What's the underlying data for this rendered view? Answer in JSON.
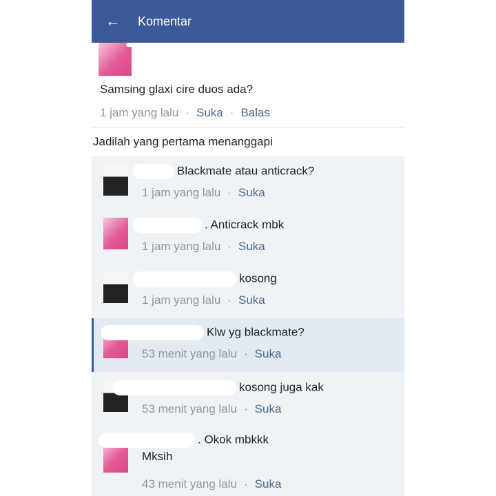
{
  "header": {
    "title": "Komentar"
  },
  "icons": {
    "back": "arrow-left-icon"
  },
  "post": {
    "text": "Samsing glaxi cire duos ada?",
    "time": "1 jam yang lalu",
    "like": "Suka",
    "reply": "Balas"
  },
  "first_reply_prompt": "Jadilah yang pertama menanggapi",
  "replies": [
    {
      "text": "Blackmate atau anticrack?",
      "time": "1 jam yang lalu",
      "like": "Suka"
    },
    {
      "text": ". Anticrack mbk",
      "time": "1 jam yang lalu",
      "like": "Suka"
    },
    {
      "text": "kosong",
      "time": "1 jam yang lalu",
      "like": "Suka"
    },
    {
      "text": "Klw yg blackmate?",
      "time": "53 menit yang lalu",
      "like": "Suka"
    },
    {
      "text": "kosong juga kak",
      "time": "53 menit yang lalu",
      "like": "Suka"
    },
    {
      "text": ". Okok mbkkk",
      "text2": "Mksih",
      "time": "43 menit yang lalu",
      "like": "Suka"
    }
  ],
  "colors": {
    "header": "#3b5998",
    "link": "#4b6890",
    "muted": "#90949c"
  }
}
